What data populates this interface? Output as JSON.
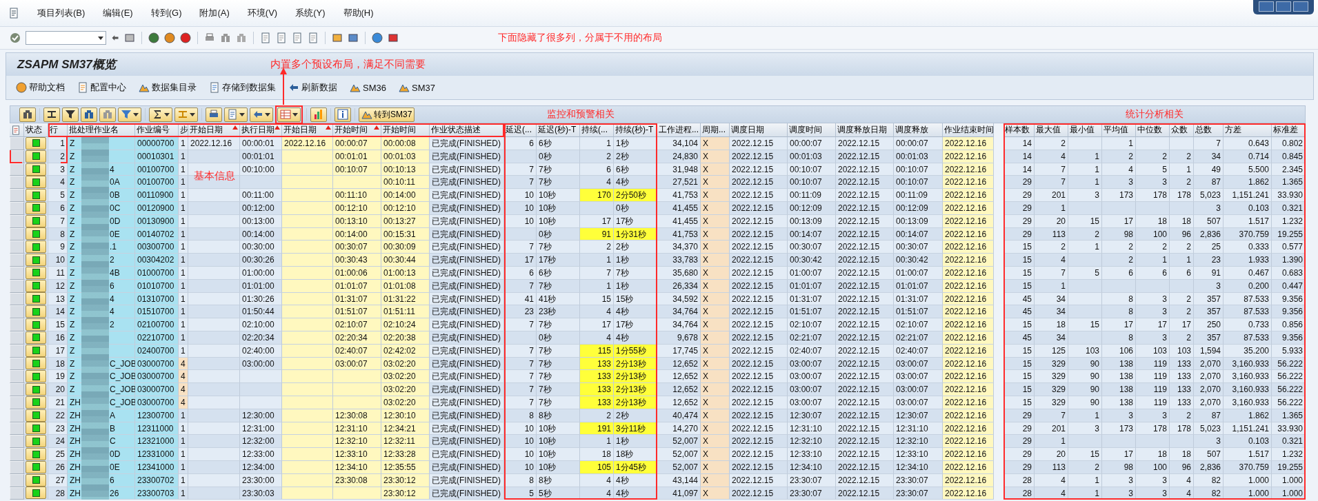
{
  "menu": [
    "项目列表(B)",
    "编辑(E)",
    "转到(G)",
    "附加(A)",
    "环境(V)",
    "系统(Y)",
    "帮助(H)"
  ],
  "toolbar_note": "下面隐藏了很多列，分属于不用的布局",
  "title": "ZSAPM SM37概览",
  "layout_note": "内置多个预设布局，满足不同需要",
  "app_buttons": [
    "帮助文档",
    "配置中心",
    "数据集目录",
    "存储到数据集",
    "刷新数据",
    "SM36",
    "SM37"
  ],
  "goto_button": "转到SM37",
  "group_notes": {
    "basic": "基本信息",
    "monitor": "监控和预警相关",
    "stats": "统计分析相关"
  },
  "columns": [
    {
      "label": "状态",
      "kind": "status",
      "sorted": false
    },
    {
      "label": "行",
      "kind": "number",
      "sorted": false
    },
    {
      "label": "批处理作业名",
      "kind": "name",
      "sorted": false
    },
    {
      "label": "作业编号",
      "kind": "key",
      "sorted": false
    },
    {
      "label": "步",
      "kind": "step",
      "sorted": false
    },
    {
      "label": "开始日期",
      "kind": "text",
      "sorted": true
    },
    {
      "label": "执行日期",
      "kind": "text",
      "sorted": true
    },
    {
      "label": "开始日期",
      "kind": "highlight",
      "sorted": true
    },
    {
      "label": "开始时间",
      "kind": "highlight",
      "sorted": true
    },
    {
      "label": "开始时间",
      "kind": "highlight",
      "sorted": false
    },
    {
      "label": "作业状态描述",
      "kind": "text",
      "sorted": false
    },
    {
      "label": "延迟(...",
      "kind": "number",
      "sorted": false
    },
    {
      "label": "延迟(秒)-T",
      "kind": "text",
      "sorted": false
    },
    {
      "label": "持续(...",
      "kind": "alert_number",
      "sorted": false
    },
    {
      "label": "持续(秒)-T",
      "kind": "alert_text",
      "sorted": false
    },
    {
      "label": "工作进程...",
      "kind": "number",
      "sorted": false
    },
    {
      "label": "周期...",
      "kind": "flag",
      "sorted": false
    },
    {
      "label": "调度日期",
      "kind": "text",
      "sorted": false
    },
    {
      "label": "调度时间",
      "kind": "text",
      "sorted": false
    },
    {
      "label": "调度释放日期",
      "kind": "text",
      "sorted": false
    },
    {
      "label": "调度释放",
      "kind": "text",
      "sorted": false
    },
    {
      "label": "作业结束时间",
      "kind": "highlight",
      "sorted": false
    },
    {
      "label": "样本数",
      "kind": "number",
      "sorted": false
    },
    {
      "label": "最大值",
      "kind": "number",
      "sorted": false
    },
    {
      "label": "最小值",
      "kind": "number",
      "sorted": false
    },
    {
      "label": "平均值",
      "kind": "number",
      "sorted": false
    },
    {
      "label": "中位数",
      "kind": "number",
      "sorted": false
    },
    {
      "label": "众数",
      "kind": "number",
      "sorted": false
    },
    {
      "label": "总数",
      "kind": "number",
      "sorted": false
    },
    {
      "label": "方差",
      "kind": "number",
      "sorted": false
    },
    {
      "label": "标准差",
      "kind": "number",
      "sorted": false
    }
  ],
  "rows": [
    {
      "color": "#19d219",
      "warning": false,
      "step_flagged": false,
      "name_end": "",
      "cells": [
        "1",
        "Z",
        "00000700",
        "1",
        "2022.12.16",
        "00:00:01",
        "2022.12.16",
        "00:00:07",
        "00:00:08",
        "已完成(FINISHED)",
        "6",
        "6秒",
        "1",
        "1秒",
        "34,104",
        "X",
        "2022.12.15",
        "00:00:07",
        "2022.12.15",
        "00:00:07",
        "2022.12.16",
        "14",
        "2",
        "",
        "1",
        "",
        "",
        "7",
        "0.643",
        "0.802"
      ]
    },
    {
      "color": "#19d219",
      "warning": false,
      "step_flagged": false,
      "name_end": "",
      "cells": [
        "2",
        "Z",
        "00010301",
        "1",
        "",
        "00:01:01",
        "",
        "00:01:01",
        "00:01:03",
        "已完成(FINISHED)",
        "",
        "0秒",
        "2",
        "2秒",
        "24,830",
        "X",
        "2022.12.15",
        "00:01:03",
        "2022.12.15",
        "00:01:03",
        "2022.12.16",
        "14",
        "4",
        "1",
        "2",
        "2",
        "2",
        "34",
        "0.714",
        "0.845"
      ]
    },
    {
      "color": "#19d219",
      "warning": false,
      "step_flagged": false,
      "name_end": "4",
      "cells": [
        "3",
        "Z",
        "00100700",
        "1",
        "",
        "00:10:00",
        "",
        "00:10:07",
        "00:10:13",
        "已完成(FINISHED)",
        "7",
        "7秒",
        "6",
        "6秒",
        "31,948",
        "X",
        "2022.12.15",
        "00:10:07",
        "2022.12.15",
        "00:10:07",
        "2022.12.16",
        "14",
        "7",
        "1",
        "4",
        "5",
        "1",
        "49",
        "5.500",
        "2.345"
      ]
    },
    {
      "color": "#19d219",
      "warning": false,
      "step_flagged": false,
      "name_end": "0A",
      "cells": [
        "4",
        "Z",
        "00100700",
        "1",
        "",
        "",
        "",
        "",
        "00:10:11",
        "已完成(FINISHED)",
        "7",
        "7秒",
        "4",
        "4秒",
        "27,521",
        "X",
        "2022.12.15",
        "00:10:07",
        "2022.12.15",
        "00:10:07",
        "2022.12.16",
        "29",
        "7",
        "1",
        "3",
        "3",
        "2",
        "87",
        "1.862",
        "1.365"
      ]
    },
    {
      "color": "#19d219",
      "warning": true,
      "step_flagged": false,
      "name_end": "0B",
      "cells": [
        "5",
        "Z",
        "00110900",
        "1",
        "",
        "00:11:00",
        "",
        "00:11:10",
        "00:14:00",
        "已完成(FINISHED)",
        "10",
        "10秒",
        "170",
        "2分50秒",
        "41,753",
        "X",
        "2022.12.15",
        "00:11:09",
        "2022.12.15",
        "00:11:09",
        "2022.12.16",
        "29",
        "201",
        "3",
        "173",
        "178",
        "178",
        "5,023",
        "1,151.241",
        "33.930"
      ]
    },
    {
      "color": "#19d219",
      "warning": false,
      "step_flagged": false,
      "name_end": "0C",
      "cells": [
        "6",
        "Z",
        "00120900",
        "1",
        "",
        "00:12:00",
        "",
        "00:12:10",
        "00:12:10",
        "已完成(FINISHED)",
        "10",
        "10秒",
        "",
        "0秒",
        "41,455",
        "X",
        "2022.12.15",
        "00:12:09",
        "2022.12.15",
        "00:12:09",
        "2022.12.16",
        "29",
        "1",
        "",
        "",
        "",
        "",
        "3",
        "0.103",
        "0.321"
      ]
    },
    {
      "color": "#19d219",
      "warning": false,
      "step_flagged": false,
      "name_end": "0D",
      "cells": [
        "7",
        "Z",
        "00130900",
        "1",
        "",
        "00:13:00",
        "",
        "00:13:10",
        "00:13:27",
        "已完成(FINISHED)",
        "10",
        "10秒",
        "17",
        "17秒",
        "41,455",
        "X",
        "2022.12.15",
        "00:13:09",
        "2022.12.15",
        "00:13:09",
        "2022.12.16",
        "29",
        "20",
        "15",
        "17",
        "18",
        "18",
        "507",
        "1.517",
        "1.232"
      ]
    },
    {
      "color": "#19d219",
      "warning": true,
      "step_flagged": false,
      "name_end": "0E",
      "cells": [
        "8",
        "Z",
        "00140702",
        "1",
        "",
        "00:14:00",
        "",
        "00:14:00",
        "00:15:31",
        "已完成(FINISHED)",
        "",
        "0秒",
        "91",
        "1分31秒",
        "41,753",
        "X",
        "2022.12.15",
        "00:14:07",
        "2022.12.15",
        "00:14:07",
        "2022.12.16",
        "29",
        "113",
        "2",
        "98",
        "100",
        "96",
        "2,836",
        "370.759",
        "19.255"
      ]
    },
    {
      "color": "#19d219",
      "warning": false,
      "step_flagged": false,
      "name_end": ".1",
      "cells": [
        "9",
        "Z",
        "00300700",
        "1",
        "",
        "00:30:00",
        "",
        "00:30:07",
        "00:30:09",
        "已完成(FINISHED)",
        "7",
        "7秒",
        "2",
        "2秒",
        "34,370",
        "X",
        "2022.12.15",
        "00:30:07",
        "2022.12.15",
        "00:30:07",
        "2022.12.16",
        "15",
        "2",
        "1",
        "2",
        "2",
        "2",
        "25",
        "0.333",
        "0.577"
      ]
    },
    {
      "color": "#19d219",
      "warning": false,
      "step_flagged": false,
      "name_end": "2",
      "cells": [
        "10",
        "Z",
        "00304202",
        "1",
        "",
        "00:30:26",
        "",
        "00:30:43",
        "00:30:44",
        "已完成(FINISHED)",
        "17",
        "17秒",
        "1",
        "1秒",
        "33,783",
        "X",
        "2022.12.15",
        "00:30:42",
        "2022.12.15",
        "00:30:42",
        "2022.12.16",
        "15",
        "4",
        "",
        "2",
        "1",
        "1",
        "23",
        "1.933",
        "1.390"
      ]
    },
    {
      "color": "#19d219",
      "warning": false,
      "step_flagged": false,
      "name_end": "4B",
      "cells": [
        "11",
        "Z",
        "01000700",
        "1",
        "",
        "01:00:00",
        "",
        "01:00:06",
        "01:00:13",
        "已完成(FINISHED)",
        "6",
        "6秒",
        "7",
        "7秒",
        "35,680",
        "X",
        "2022.12.15",
        "01:00:07",
        "2022.12.15",
        "01:00:07",
        "2022.12.16",
        "15",
        "7",
        "5",
        "6",
        "6",
        "6",
        "91",
        "0.467",
        "0.683"
      ]
    },
    {
      "color": "#19d219",
      "warning": false,
      "step_flagged": false,
      "name_end": "6",
      "cells": [
        "12",
        "Z",
        "01010700",
        "1",
        "",
        "01:01:00",
        "",
        "01:01:07",
        "01:01:08",
        "已完成(FINISHED)",
        "7",
        "7秒",
        "1",
        "1秒",
        "26,334",
        "X",
        "2022.12.15",
        "01:01:07",
        "2022.12.15",
        "01:01:07",
        "2022.12.16",
        "15",
        "1",
        "",
        "",
        "",
        "",
        "3",
        "0.200",
        "0.447"
      ]
    },
    {
      "color": "#19d219",
      "warning": false,
      "step_flagged": false,
      "name_end": "4",
      "cells": [
        "13",
        "Z",
        "01310700",
        "1",
        "",
        "01:30:26",
        "",
        "01:31:07",
        "01:31:22",
        "已完成(FINISHED)",
        "41",
        "41秒",
        "15",
        "15秒",
        "34,592",
        "X",
        "2022.12.15",
        "01:31:07",
        "2022.12.15",
        "01:31:07",
        "2022.12.16",
        "45",
        "34",
        "",
        "8",
        "3",
        "2",
        "357",
        "87.533",
        "9.356"
      ]
    },
    {
      "color": "#19d219",
      "warning": false,
      "step_flagged": false,
      "name_end": "4",
      "cells": [
        "14",
        "Z",
        "01510700",
        "1",
        "",
        "01:50:44",
        "",
        "01:51:07",
        "01:51:11",
        "已完成(FINISHED)",
        "23",
        "23秒",
        "4",
        "4秒",
        "34,764",
        "X",
        "2022.12.15",
        "01:51:07",
        "2022.12.15",
        "01:51:07",
        "2022.12.16",
        "45",
        "34",
        "",
        "8",
        "3",
        "2",
        "357",
        "87.533",
        "9.356"
      ]
    },
    {
      "color": "#19d219",
      "warning": false,
      "step_flagged": false,
      "name_end": "2",
      "cells": [
        "15",
        "Z",
        "02100700",
        "1",
        "",
        "02:10:00",
        "",
        "02:10:07",
        "02:10:24",
        "已完成(FINISHED)",
        "7",
        "7秒",
        "17",
        "17秒",
        "34,764",
        "X",
        "2022.12.15",
        "02:10:07",
        "2022.12.15",
        "02:10:07",
        "2022.12.16",
        "15",
        "18",
        "15",
        "17",
        "17",
        "17",
        "250",
        "0.733",
        "0.856"
      ]
    },
    {
      "color": "#19d219",
      "warning": false,
      "step_flagged": false,
      "name_end": "",
      "cells": [
        "16",
        "Z",
        "02210700",
        "1",
        "",
        "02:20:34",
        "",
        "02:20:34",
        "02:20:38",
        "已完成(FINISHED)",
        "",
        "0秒",
        "4",
        "4秒",
        "9,678",
        "X",
        "2022.12.15",
        "02:21:07",
        "2022.12.15",
        "02:21:07",
        "2022.12.16",
        "45",
        "34",
        "",
        "8",
        "3",
        "2",
        "357",
        "87.533",
        "9.356"
      ]
    },
    {
      "color": "#19d219",
      "warning": true,
      "step_flagged": false,
      "name_end": "",
      "cells": [
        "17",
        "Z",
        "02400700",
        "1",
        "",
        "02:40:00",
        "",
        "02:40:07",
        "02:42:02",
        "已完成(FINISHED)",
        "7",
        "7秒",
        "115",
        "1分55秒",
        "17,745",
        "X",
        "2022.12.15",
        "02:40:07",
        "2022.12.15",
        "02:40:07",
        "2022.12.16",
        "15",
        "125",
        "103",
        "106",
        "103",
        "103",
        "1,594",
        "35.200",
        "5.933"
      ]
    },
    {
      "color": "#19d219",
      "warning": true,
      "step_flagged": true,
      "name_end": "C_JOB",
      "cells": [
        "18",
        "Z",
        "03000700",
        "4",
        "",
        "03:00:00",
        "",
        "03:00:07",
        "03:02:20",
        "已完成(FINISHED)",
        "7",
        "7秒",
        "133",
        "2分13秒",
        "12,652",
        "X",
        "2022.12.15",
        "03:00:07",
        "2022.12.15",
        "03:00:07",
        "2022.12.16",
        "15",
        "329",
        "90",
        "138",
        "119",
        "133",
        "2,070",
        "3,160.933",
        "56.222"
      ]
    },
    {
      "color": "#19d219",
      "warning": true,
      "step_flagged": true,
      "name_end": "C_JOB",
      "cells": [
        "19",
        "Z",
        "03000700",
        "4",
        "",
        "",
        "",
        "",
        "03:02:20",
        "已完成(FINISHED)",
        "7",
        "7秒",
        "133",
        "2分13秒",
        "12,652",
        "X",
        "2022.12.15",
        "03:00:07",
        "2022.12.15",
        "03:00:07",
        "2022.12.16",
        "15",
        "329",
        "90",
        "138",
        "119",
        "133",
        "2,070",
        "3,160.933",
        "56.222"
      ]
    },
    {
      "color": "#19d219",
      "warning": true,
      "step_flagged": true,
      "name_end": "C_JOB",
      "cells": [
        "20",
        "Z",
        "03000700",
        "4",
        "",
        "",
        "",
        "",
        "03:02:20",
        "已完成(FINISHED)",
        "7",
        "7秒",
        "133",
        "2分13秒",
        "12,652",
        "X",
        "2022.12.15",
        "03:00:07",
        "2022.12.15",
        "03:00:07",
        "2022.12.16",
        "15",
        "329",
        "90",
        "138",
        "119",
        "133",
        "2,070",
        "3,160.933",
        "56.222"
      ]
    },
    {
      "color": "#19d219",
      "warning": true,
      "step_flagged": true,
      "name_end": "C_JOB",
      "cells": [
        "21",
        "ZH",
        "03000700",
        "4",
        "",
        "",
        "",
        "",
        "03:02:20",
        "已完成(FINISHED)",
        "7",
        "7秒",
        "133",
        "2分13秒",
        "12,652",
        "X",
        "2022.12.15",
        "03:00:07",
        "2022.12.15",
        "03:00:07",
        "2022.12.16",
        "15",
        "329",
        "90",
        "138",
        "119",
        "133",
        "2,070",
        "3,160.933",
        "56.222"
      ]
    },
    {
      "color": "#19d219",
      "warning": false,
      "step_flagged": false,
      "name_end": "A",
      "cells": [
        "22",
        "ZH",
        "12300700",
        "1",
        "",
        "12:30:00",
        "",
        "12:30:08",
        "12:30:10",
        "已完成(FINISHED)",
        "8",
        "8秒",
        "2",
        "2秒",
        "40,474",
        "X",
        "2022.12.15",
        "12:30:07",
        "2022.12.15",
        "12:30:07",
        "2022.12.16",
        "29",
        "7",
        "1",
        "3",
        "3",
        "2",
        "87",
        "1.862",
        "1.365"
      ]
    },
    {
      "color": "#19d219",
      "warning": true,
      "step_flagged": false,
      "name_end": "B",
      "cells": [
        "23",
        "ZH",
        "12311000",
        "1",
        "",
        "12:31:00",
        "",
        "12:31:10",
        "12:34:21",
        "已完成(FINISHED)",
        "10",
        "10秒",
        "191",
        "3分11秒",
        "14,270",
        "X",
        "2022.12.15",
        "12:31:10",
        "2022.12.15",
        "12:31:10",
        "2022.12.16",
        "29",
        "201",
        "3",
        "173",
        "178",
        "178",
        "5,023",
        "1,151.241",
        "33.930"
      ]
    },
    {
      "color": "#19d219",
      "warning": false,
      "step_flagged": false,
      "name_end": "C",
      "cells": [
        "24",
        "ZH",
        "12321000",
        "1",
        "",
        "12:32:00",
        "",
        "12:32:10",
        "12:32:11",
        "已完成(FINISHED)",
        "10",
        "10秒",
        "1",
        "1秒",
        "52,007",
        "X",
        "2022.12.15",
        "12:32:10",
        "2022.12.15",
        "12:32:10",
        "2022.12.16",
        "29",
        "1",
        "",
        "",
        "",
        "",
        "3",
        "0.103",
        "0.321"
      ]
    },
    {
      "color": "#19d219",
      "warning": false,
      "step_flagged": false,
      "name_end": "0D",
      "cells": [
        "25",
        "ZH",
        "12331000",
        "1",
        "",
        "12:33:00",
        "",
        "12:33:10",
        "12:33:28",
        "已完成(FINISHED)",
        "10",
        "10秒",
        "18",
        "18秒",
        "52,007",
        "X",
        "2022.12.15",
        "12:33:10",
        "2022.12.15",
        "12:33:10",
        "2022.12.16",
        "29",
        "20",
        "15",
        "17",
        "18",
        "18",
        "507",
        "1.517",
        "1.232"
      ]
    },
    {
      "color": "#19d219",
      "warning": true,
      "step_flagged": false,
      "name_end": "0E",
      "cells": [
        "26",
        "ZH",
        "12341000",
        "1",
        "",
        "12:34:00",
        "",
        "12:34:10",
        "12:35:55",
        "已完成(FINISHED)",
        "10",
        "10秒",
        "105",
        "1分45秒",
        "52,007",
        "X",
        "2022.12.15",
        "12:34:10",
        "2022.12.15",
        "12:34:10",
        "2022.12.16",
        "29",
        "113",
        "2",
        "98",
        "100",
        "96",
        "2,836",
        "370.759",
        "19.255"
      ]
    },
    {
      "color": "#19d219",
      "warning": false,
      "step_flagged": false,
      "name_end": "6",
      "cells": [
        "27",
        "ZH",
        "23300702",
        "1",
        "",
        "23:30:00",
        "",
        "23:30:08",
        "23:30:12",
        "已完成(FINISHED)",
        "8",
        "8秒",
        "4",
        "4秒",
        "43,144",
        "X",
        "2022.12.15",
        "23:30:07",
        "2022.12.15",
        "23:30:07",
        "2022.12.16",
        "28",
        "4",
        "1",
        "3",
        "3",
        "4",
        "82",
        "1.000",
        "1.000"
      ]
    },
    {
      "color": "#19d219",
      "warning": false,
      "step_flagged": false,
      "name_end": "26",
      "cells": [
        "28",
        "ZH",
        "23300703",
        "1",
        "",
        "23:30:03",
        "",
        "",
        "23:30:12",
        "已完成(FINISHED)",
        "5",
        "5秒",
        "4",
        "4秒",
        "41,097",
        "X",
        "2022.12.15",
        "23:30:07",
        "2022.12.15",
        "23:30:07",
        "2022.12.16",
        "28",
        "4",
        "1",
        "3",
        "3",
        "4",
        "82",
        "1.000",
        "1.000"
      ]
    }
  ]
}
